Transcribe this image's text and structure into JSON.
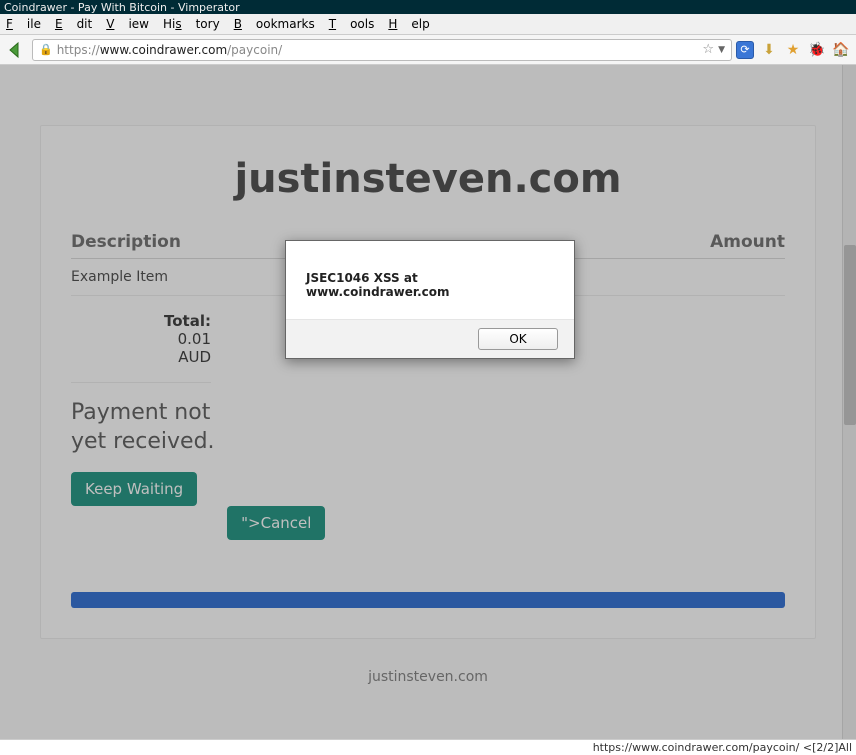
{
  "window": {
    "title": "Coindrawer - Pay With Bitcoin - Vimperator"
  },
  "menu": {
    "file": "File",
    "edit": "Edit",
    "view": "View",
    "history": "History",
    "bookmarks": "Bookmarks",
    "tools": "Tools",
    "help": "Help"
  },
  "url": {
    "proto": "https://",
    "host": "www.coindrawer.com",
    "path": "/paycoin/"
  },
  "page": {
    "brand": "justinsteven.com",
    "columns": {
      "desc": "Description",
      "amount": "Amount"
    },
    "item": "Example Item",
    "totals": {
      "label": "Total:",
      "value": "0.01",
      "currency": "AUD"
    },
    "status": "Payment not yet received.",
    "buttons": {
      "wait": "Keep Waiting",
      "cancel": "\">Cancel"
    },
    "footer": "justinsteven.com"
  },
  "alert": {
    "message": "JSEC1046 XSS at www.coindrawer.com",
    "ok": "OK"
  },
  "statusbar": "https://www.coindrawer.com/paycoin/ <[2/2]All"
}
